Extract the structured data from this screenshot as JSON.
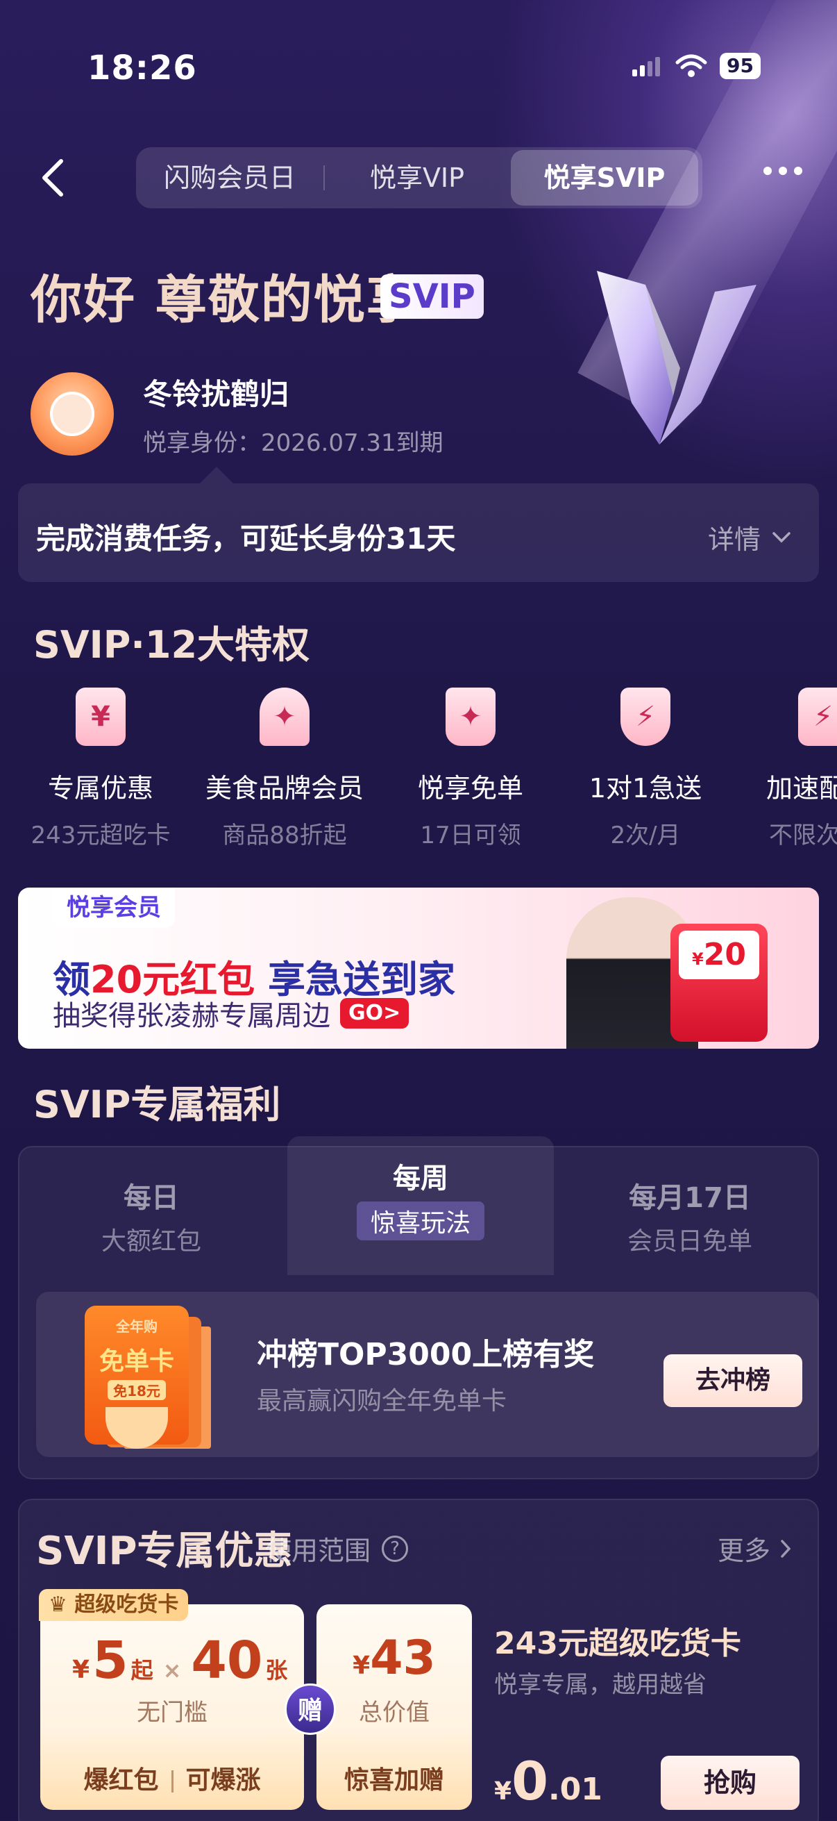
{
  "status_bar": {
    "time": "18:26",
    "battery": "95"
  },
  "nav": {
    "tabs": [
      {
        "label": "闪购会员日",
        "active": false
      },
      {
        "label": "悦享VIP",
        "active": false
      },
      {
        "label": "悦享SVIP",
        "active": true
      }
    ]
  },
  "hero": {
    "greeting": "你好 尊敬的悦享",
    "badge": "SVIP",
    "username": "冬铃扰鹤归",
    "expire": "悦享身份：2026.07.31到期"
  },
  "task": {
    "text": "完成消费任务，可延长身份31天",
    "detail_label": "详情"
  },
  "privileges": {
    "title": "SVIP·12大特权",
    "items": [
      {
        "icon": "yen-ticket-icon",
        "glyph": "¥",
        "name": "专属优惠",
        "sub": "243元超吃卡"
      },
      {
        "icon": "food-cloche-icon",
        "glyph": "✦",
        "name": "美食品牌会员",
        "sub": "商品88折起"
      },
      {
        "icon": "drink-cup-icon",
        "glyph": "✦",
        "name": "悦享免单",
        "sub": "17日可领"
      },
      {
        "icon": "lightning-shield-icon",
        "glyph": "⚡",
        "name": "1对1急送",
        "sub": "2次/月"
      },
      {
        "icon": "lightning-card-icon",
        "glyph": "⚡",
        "name": "加速配",
        "sub": "不限次"
      }
    ]
  },
  "banner": {
    "logo": "悦享会员",
    "main_prefix": "领",
    "main_highlight": "20元红包",
    "main_suffix": " 享急送到家",
    "sub": "抽奖得张凌赫专属周边",
    "go": "GO>",
    "redpack_amount": "20",
    "redpack_currency": "¥"
  },
  "welfare": {
    "title": "SVIP专属福利",
    "tabs": [
      {
        "title": "每日",
        "sub": "大额红包",
        "active": false
      },
      {
        "title": "每周",
        "sub": "惊喜玩法",
        "active": true
      },
      {
        "title": "每月17日",
        "sub": "会员日免单",
        "active": false
      }
    ],
    "card": {
      "badge_top": "全年购",
      "badge_title": "免单卡",
      "badge_sub": "免18元",
      "title": "冲榜TOP3000上榜有奖",
      "sub": "最高赢闪购全年免单卡",
      "button": "去冲榜"
    }
  },
  "offers": {
    "title": "SVIP专属优惠",
    "scope": "使用范围",
    "more": "更多",
    "coupon1": {
      "tag": "超级吃货卡",
      "yen": "¥",
      "amount": "5",
      "from": "起",
      "x": "×",
      "count": "40",
      "unit": "张",
      "note": "无门槛",
      "foot_left": "爆红包",
      "foot_right": "可爆涨"
    },
    "gift": "赠",
    "coupon2": {
      "yen": "¥",
      "amount": "43",
      "note": "总价值",
      "foot": "惊喜加赠"
    },
    "product": {
      "name": "243元超级吃货卡",
      "desc": "悦享专属，越用越省",
      "price_yen": "¥",
      "price_int": "0",
      "price_dec": ".01",
      "button": "抢购"
    }
  }
}
